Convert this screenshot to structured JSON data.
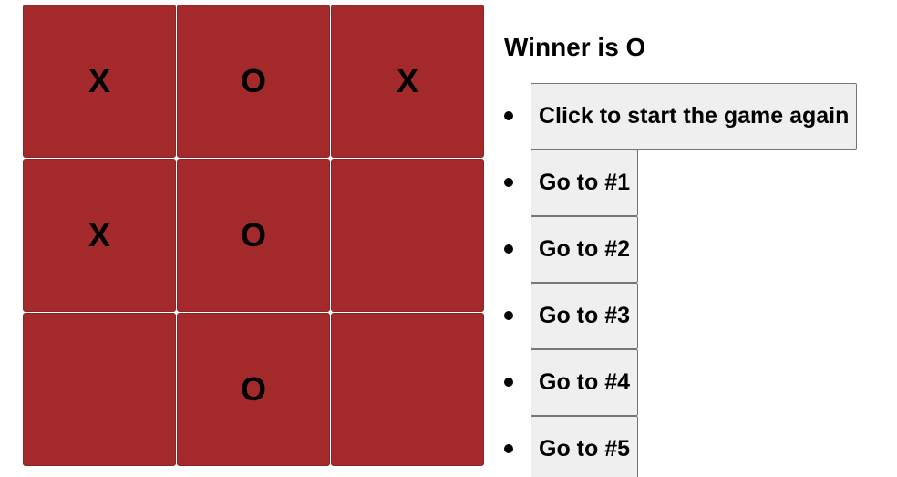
{
  "status": "Winner is O",
  "board": [
    "X",
    "O",
    "X",
    "X",
    "O",
    "",
    "",
    "O",
    ""
  ],
  "moves": [
    "Click to start the game again",
    "Go to #1",
    "Go to #2",
    "Go to #3",
    "Go to #4",
    "Go to #5"
  ],
  "colors": {
    "square_bg": "#a4292b",
    "button_bg": "#efefef",
    "text": "#000000"
  }
}
